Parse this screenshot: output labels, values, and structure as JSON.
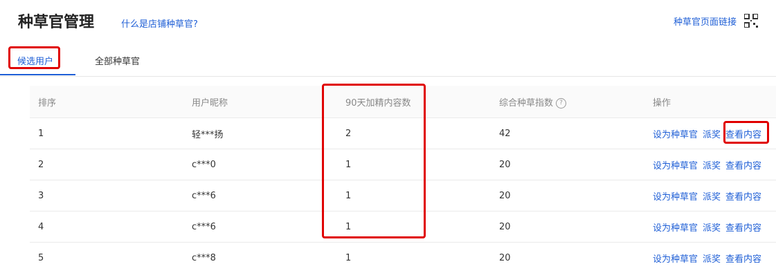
{
  "header": {
    "title": "种草官管理",
    "help_link": "什么是店铺种草官?",
    "page_link": "种草官页面链接",
    "qr_icon": "qr-code-icon"
  },
  "tabs": [
    {
      "label": "候选用户",
      "active": true
    },
    {
      "label": "全部种草官",
      "active": false
    }
  ],
  "table": {
    "columns": [
      "排序",
      "用户昵称",
      "90天加精内容数",
      "综合种草指数",
      "操作"
    ],
    "rows": [
      {
        "rank": "1",
        "nickname": "轻***扬",
        "count": "2",
        "index": "42"
      },
      {
        "rank": "2",
        "nickname": "c***0",
        "count": "1",
        "index": "20"
      },
      {
        "rank": "3",
        "nickname": "c***6",
        "count": "1",
        "index": "20"
      },
      {
        "rank": "4",
        "nickname": "c***6",
        "count": "1",
        "index": "20"
      },
      {
        "rank": "5",
        "nickname": "c***8",
        "count": "1",
        "index": "20"
      }
    ],
    "actions": {
      "set": "设为种草官",
      "reward": "派奖",
      "view": "查看内容"
    }
  },
  "colors": {
    "accent": "#1f5fd6",
    "highlight": "#e00000"
  }
}
